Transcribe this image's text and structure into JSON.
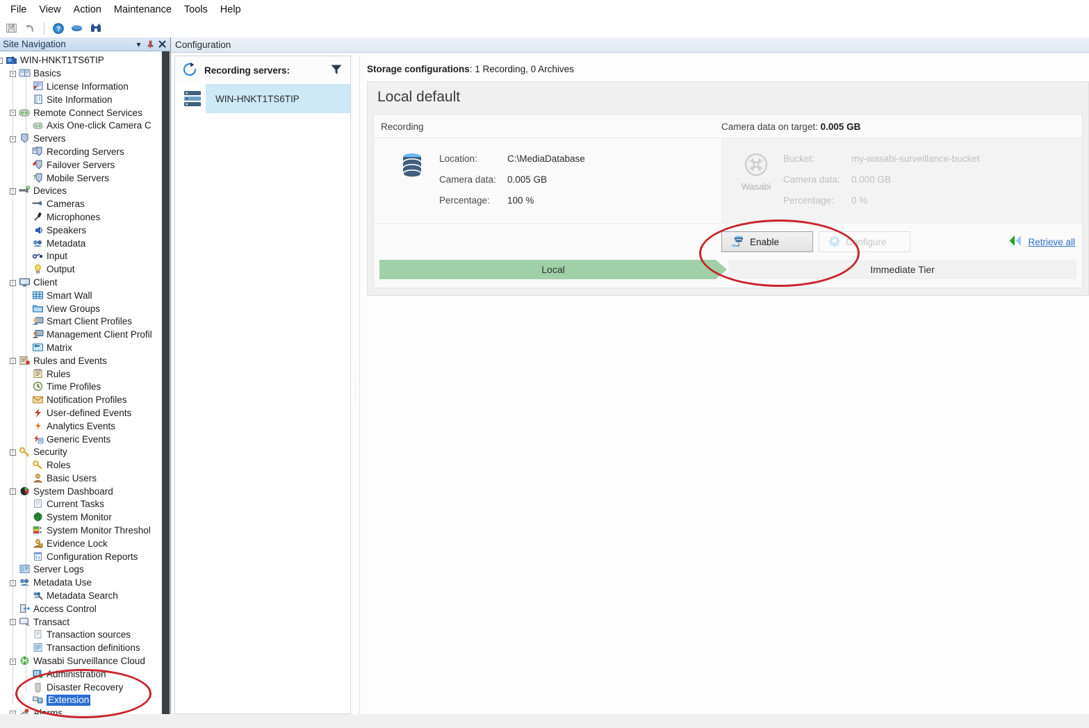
{
  "menu": {
    "items": [
      "File",
      "View",
      "Action",
      "Maintenance",
      "Tools",
      "Help"
    ]
  },
  "toolbar": {
    "buttons": [
      {
        "name": "save-icon",
        "label": "Save",
        "enabled": false
      },
      {
        "name": "undo-icon",
        "label": "Undo",
        "enabled": false
      },
      {
        "name": "help-icon",
        "label": "Help",
        "enabled": true
      },
      {
        "name": "book-icon",
        "label": "Documentation",
        "enabled": true
      },
      {
        "name": "binoculars-icon",
        "label": "Find",
        "enabled": true
      }
    ]
  },
  "sidebar": {
    "title": "Site Navigation",
    "controls": [
      "dropdown-arrow",
      "pin",
      "close"
    ],
    "tree": [
      {
        "label": "WIN-HNKT1TS6TIP",
        "depth": 0,
        "icon": "site-icon",
        "expander": "-"
      },
      {
        "label": "Basics",
        "depth": 1,
        "icon": "book-icon",
        "expander": "-"
      },
      {
        "label": "License Information",
        "depth": 2,
        "icon": "license-icon"
      },
      {
        "label": "Site Information",
        "depth": 2,
        "icon": "info-icon"
      },
      {
        "label": "Remote Connect Services",
        "depth": 1,
        "icon": "remote-connect-icon",
        "expander": "-"
      },
      {
        "label": "Axis One-click Camera C",
        "depth": 2,
        "icon": "axis-camera-icon"
      },
      {
        "label": "Servers",
        "depth": 1,
        "icon": "servers-icon",
        "expander": "-"
      },
      {
        "label": "Recording Servers",
        "depth": 2,
        "icon": "recording-server-icon"
      },
      {
        "label": "Failover Servers",
        "depth": 2,
        "icon": "failover-server-icon"
      },
      {
        "label": "Mobile Servers",
        "depth": 2,
        "icon": "mobile-server-icon"
      },
      {
        "label": "Devices",
        "depth": 1,
        "icon": "devices-icon",
        "expander": "-"
      },
      {
        "label": "Cameras",
        "depth": 2,
        "icon": "camera-icon"
      },
      {
        "label": "Microphones",
        "depth": 2,
        "icon": "microphone-icon"
      },
      {
        "label": "Speakers",
        "depth": 2,
        "icon": "speaker-icon"
      },
      {
        "label": "Metadata",
        "depth": 2,
        "icon": "metadata-icon"
      },
      {
        "label": "Input",
        "depth": 2,
        "icon": "input-icon"
      },
      {
        "label": "Output",
        "depth": 2,
        "icon": "output-icon"
      },
      {
        "label": "Client",
        "depth": 1,
        "icon": "client-icon",
        "expander": "-"
      },
      {
        "label": "Smart Wall",
        "depth": 2,
        "icon": "smart-wall-icon"
      },
      {
        "label": "View Groups",
        "depth": 2,
        "icon": "view-groups-icon"
      },
      {
        "label": "Smart Client Profiles",
        "depth": 2,
        "icon": "smart-client-profiles-icon"
      },
      {
        "label": "Management Client Profil",
        "depth": 2,
        "icon": "management-client-profiles-icon"
      },
      {
        "label": "Matrix",
        "depth": 2,
        "icon": "matrix-icon"
      },
      {
        "label": "Rules and Events",
        "depth": 1,
        "icon": "rules-events-icon",
        "expander": "-"
      },
      {
        "label": "Rules",
        "depth": 2,
        "icon": "rules-icon"
      },
      {
        "label": "Time Profiles",
        "depth": 2,
        "icon": "time-profiles-icon"
      },
      {
        "label": "Notification Profiles",
        "depth": 2,
        "icon": "notification-profiles-icon"
      },
      {
        "label": "User-defined Events",
        "depth": 2,
        "icon": "user-defined-events-icon"
      },
      {
        "label": "Analytics Events",
        "depth": 2,
        "icon": "analytics-events-icon"
      },
      {
        "label": "Generic Events",
        "depth": 2,
        "icon": "generic-events-icon"
      },
      {
        "label": "Security",
        "depth": 1,
        "icon": "security-icon",
        "expander": "-"
      },
      {
        "label": "Roles",
        "depth": 2,
        "icon": "roles-icon"
      },
      {
        "label": "Basic Users",
        "depth": 2,
        "icon": "basic-users-icon"
      },
      {
        "label": "System Dashboard",
        "depth": 1,
        "icon": "system-dashboard-icon",
        "expander": "-"
      },
      {
        "label": "Current Tasks",
        "depth": 2,
        "icon": "current-tasks-icon"
      },
      {
        "label": "System Monitor",
        "depth": 2,
        "icon": "system-monitor-icon"
      },
      {
        "label": "System Monitor Threshol",
        "depth": 2,
        "icon": "system-monitor-thresholds-icon"
      },
      {
        "label": "Evidence Lock",
        "depth": 2,
        "icon": "evidence-lock-icon"
      },
      {
        "label": "Configuration Reports",
        "depth": 2,
        "icon": "configuration-reports-icon"
      },
      {
        "label": "Server Logs",
        "depth": 1,
        "icon": "server-logs-icon"
      },
      {
        "label": "Metadata Use",
        "depth": 1,
        "icon": "metadata-use-icon",
        "expander": "-"
      },
      {
        "label": "Metadata Search",
        "depth": 2,
        "icon": "metadata-search-icon"
      },
      {
        "label": "Access Control",
        "depth": 1,
        "icon": "access-control-icon"
      },
      {
        "label": "Transact",
        "depth": 1,
        "icon": "transact-icon",
        "expander": "-"
      },
      {
        "label": "Transaction sources",
        "depth": 2,
        "icon": "transaction-sources-icon"
      },
      {
        "label": "Transaction definitions",
        "depth": 2,
        "icon": "transaction-definitions-icon"
      },
      {
        "label": "Wasabi Surveillance Cloud",
        "depth": 1,
        "icon": "wasabi-cloud-icon",
        "expander": "-"
      },
      {
        "label": "Administration",
        "depth": 2,
        "icon": "administration-icon"
      },
      {
        "label": "Disaster Recovery",
        "depth": 2,
        "icon": "disaster-recovery-icon"
      },
      {
        "label": "Extension",
        "depth": 2,
        "icon": "extension-icon",
        "selected": true
      },
      {
        "label": "Alarms",
        "depth": 1,
        "icon": "alarms-icon",
        "expander": "-"
      }
    ]
  },
  "right": {
    "tab_label": "Configuration",
    "servers_panel": {
      "refresh_icon": "refresh-icon",
      "title": "Recording servers:",
      "filter_icon": "filter-icon",
      "items": [
        {
          "name": "WIN-HNKT1TS6TIP",
          "icon": "server-icon",
          "selected": true
        }
      ]
    },
    "detail": {
      "storage_label": "Storage configurations",
      "storage_value": "1 Recording, 0 Archives",
      "card_title": "Local default",
      "recording_label": "Recording",
      "camera_data_on_target_label": "Camera data on target",
      "camera_data_on_target_value": "0.005 GB",
      "local": {
        "icon": "database-icon",
        "rows": [
          {
            "key": "Location:",
            "value": "C:\\MediaDatabase"
          },
          {
            "key": "Camera data:",
            "value": "0.005 GB"
          },
          {
            "key": "Percentage:",
            "value": "100 %"
          }
        ]
      },
      "cloud": {
        "icon": "wasabi-logo-icon",
        "caption": "Wasabi",
        "rows": [
          {
            "key": "Bucket:",
            "value": "my-wasabi-surveillance-bucket"
          },
          {
            "key": "Camera data:",
            "value": "0.000 GB"
          },
          {
            "key": "Percentage:",
            "value": "0 %"
          }
        ]
      },
      "actions": {
        "enable_label": "Enable",
        "enable_icon": "enable-storage-icon",
        "configure_label": "Configure",
        "configure_icon": "gear-icon",
        "configure_disabled": true,
        "retrieve_label": "Retrieve all",
        "retrieve_icon": "double-chevron-left-icon"
      },
      "tiers": [
        {
          "label": "Local",
          "color": "#9fd0a8"
        },
        {
          "label": "Immediate Tier",
          "color": "#f1f1f1"
        }
      ]
    }
  },
  "annotations": {
    "highlight_color": "#c9252d",
    "ellipses": [
      "enable-button-highlight",
      "extension-tree-item-highlight"
    ]
  }
}
